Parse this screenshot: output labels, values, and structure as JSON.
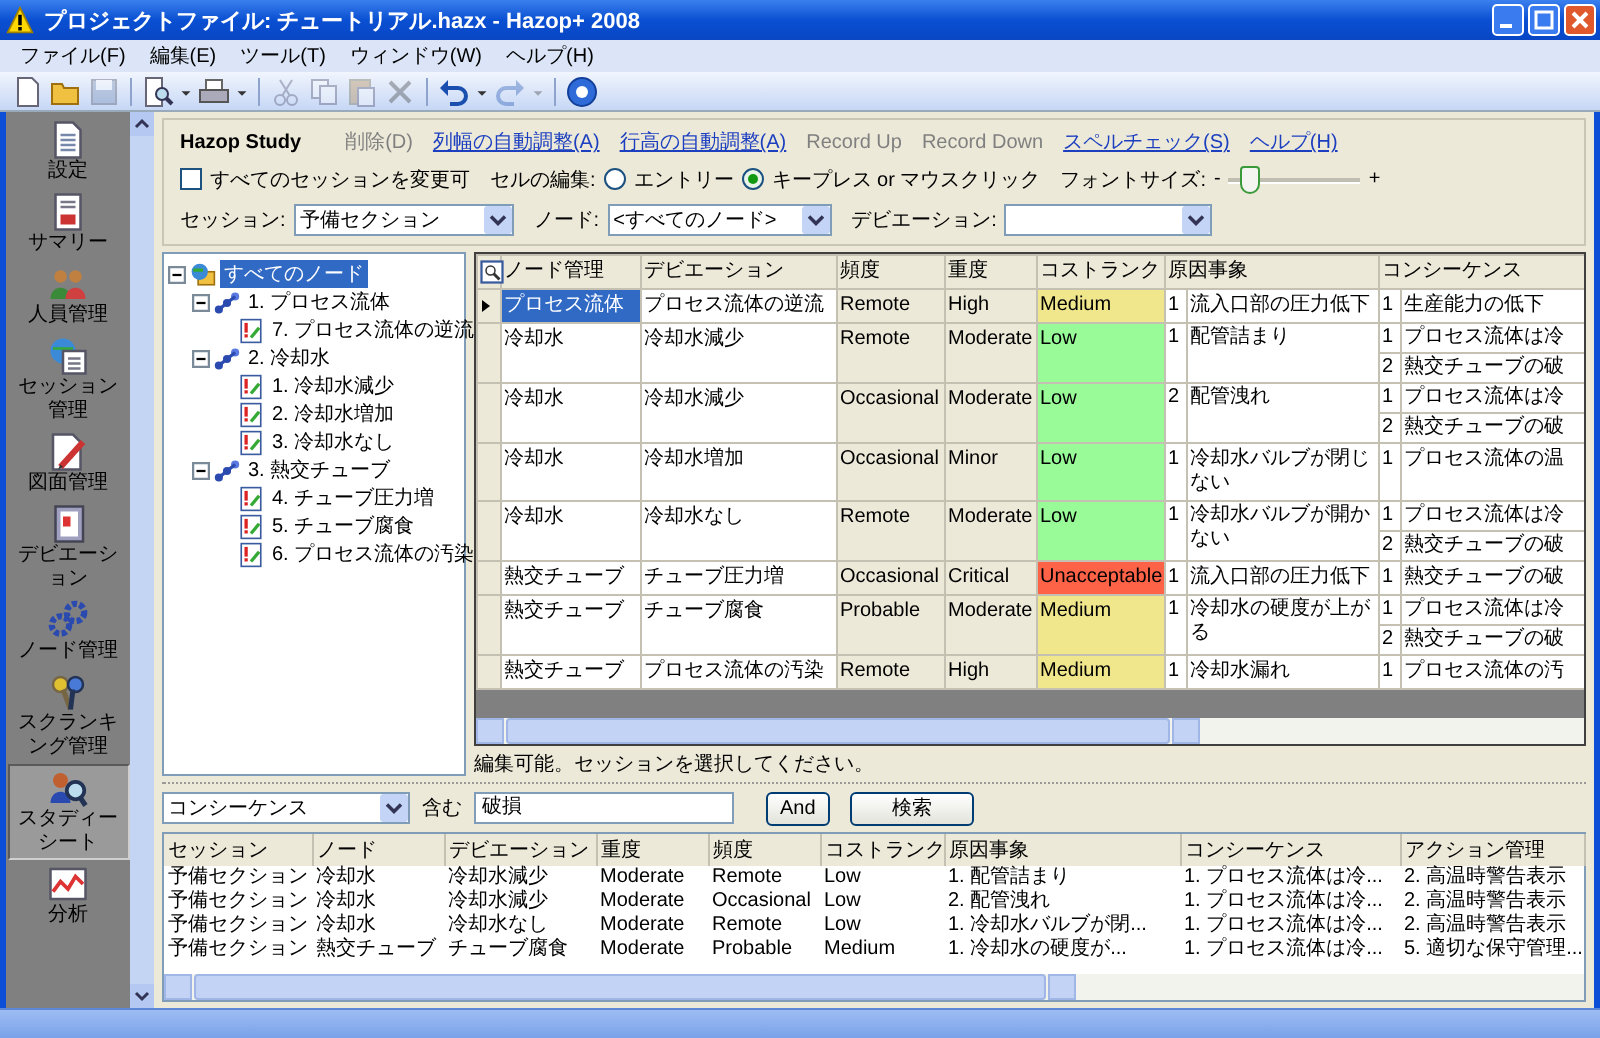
{
  "window": {
    "title": "プロジェクトファイル: チュートリアル.hazx - Hazop+ 2008"
  },
  "menu": [
    "ファイル(F)",
    "編集(E)",
    "ツール(T)",
    "ウィンドウ(W)",
    "ヘルプ(H)"
  ],
  "toolbar": [
    {
      "disabled": false,
      "dropdown": false
    },
    {
      "disabled": false,
      "dropdown": false
    },
    {
      "disabled": true,
      "dropdown": false
    },
    {
      "disabled": false,
      "dropdown": true
    },
    {
      "disabled": false,
      "dropdown": true
    },
    {
      "disabled": true,
      "dropdown": false
    },
    {
      "disabled": true,
      "dropdown": false
    },
    {
      "disabled": true,
      "dropdown": false
    },
    {
      "disabled": true,
      "dropdown": false
    },
    {
      "disabled": false,
      "dropdown": true
    },
    {
      "disabled": true,
      "dropdown": true
    },
    {
      "disabled": false,
      "dropdown": false
    }
  ],
  "sidebar": {
    "items": [
      {
        "label": "設定",
        "selected": false
      },
      {
        "label": "サマリー",
        "selected": false
      },
      {
        "label": "人員管理",
        "selected": false
      },
      {
        "label": "セッション管理",
        "selected": false
      },
      {
        "label": "図面管理",
        "selected": false
      },
      {
        "label": "デビエーション",
        "selected": false
      },
      {
        "label": "ノード管理",
        "selected": false
      },
      {
        "label": "スクランキング管理",
        "selected": false
      },
      {
        "label": "スタディーシート",
        "selected": true
      },
      {
        "label": "分析",
        "selected": false
      }
    ]
  },
  "study": {
    "title": "Hazop Study",
    "links": [
      {
        "label": "削除(D)",
        "disabled": true
      },
      {
        "label": "列幅の自動調整(A)",
        "disabled": false
      },
      {
        "label": "行高の自動調整(A)",
        "disabled": false
      },
      {
        "label": "Record Up",
        "disabled": true
      },
      {
        "label": "Record Down",
        "disabled": true
      },
      {
        "label": "スペルチェック(S)",
        "disabled": false
      },
      {
        "label": "ヘルプ(H)",
        "disabled": false
      }
    ],
    "all_sessions": {
      "label": "すべてのセッションを変更可",
      "checked": false
    },
    "cell_edit": {
      "label": "セルの編集:",
      "options": [
        {
          "label": "エントリー",
          "selected": false
        },
        {
          "label": "キープレス or マウスクリック",
          "selected": true
        }
      ]
    },
    "font_size": {
      "label": "フォントサイズ:",
      "minus": "-",
      "plus": "+",
      "level": 0.1
    },
    "filters": [
      {
        "label": "セッション:",
        "value": "予備セクション"
      },
      {
        "label": "ノード:",
        "value": "<すべてのノード>"
      },
      {
        "label": "デビエーション:"
      }
    ]
  },
  "tree": {
    "label": "すべてのノード",
    "selected": true,
    "expanded": true,
    "children": [
      {
        "label": "1. プロセス流体",
        "selected": false,
        "expanded": true,
        "children": [
          {
            "label": "7. プロセス流体の逆流",
            "selected": false
          }
        ]
      },
      {
        "label": "2. 冷却水",
        "selected": false,
        "expanded": true,
        "children": [
          {
            "label": "1. 冷却水減少",
            "selected": false
          },
          {
            "label": "2. 冷却水増加",
            "selected": false
          },
          {
            "label": "3. 冷却水なし",
            "selected": false
          }
        ]
      },
      {
        "label": "3. 熱交チューブ",
        "selected": false,
        "expanded": true,
        "children": [
          {
            "label": "4. チューブ圧力増",
            "selected": false
          },
          {
            "label": "5. チューブ腐食",
            "selected": false
          },
          {
            "label": "6. プロセス流体の汚染",
            "selected": false
          }
        ]
      }
    ]
  },
  "grid": {
    "columns": [
      "ノード管理",
      "デビエーション",
      "頻度",
      "重度",
      "コストランク",
      "原因事象",
      "コンシーケンス"
    ],
    "rows": [
      {
        "selected": true,
        "node": "プロセス流体",
        "deviation": "プロセス流体の逆流",
        "frequency": "Remote",
        "severity": "High",
        "cost_rank": "Medium",
        "color": "#f0e68c",
        "causes": [
          {
            "no": "1",
            "text": "流入口部の圧力低下"
          }
        ],
        "consequences": [
          {
            "no": "1",
            "text": "生産能力の低下"
          }
        ]
      },
      {
        "selected": false,
        "node": "冷却水",
        "deviation": "冷却水減少",
        "frequency": "Remote",
        "severity": "Moderate",
        "cost_rank": "Low",
        "color": "#98fb98",
        "causes": [
          {
            "no": "1",
            "text": "配管詰まり"
          }
        ],
        "consequences": [
          {
            "no": "1",
            "text": "プロセス流体は冷"
          },
          {
            "no": "2",
            "text": "熱交チューブの破"
          }
        ]
      },
      {
        "selected": false,
        "node": "冷却水",
        "deviation": "冷却水減少",
        "frequency": "Occasional",
        "severity": "Moderate",
        "cost_rank": "Low",
        "color": "#98fb98",
        "causes": [
          {
            "no": "2",
            "text": "配管洩れ"
          }
        ],
        "consequences": [
          {
            "no": "1",
            "text": "プロセス流体は冷"
          },
          {
            "no": "2",
            "text": "熱交チューブの破"
          }
        ]
      },
      {
        "selected": false,
        "node": "冷却水",
        "deviation": "冷却水増加",
        "frequency": "Occasional",
        "severity": "Minor",
        "cost_rank": "Low",
        "color": "#98fb98",
        "causes": [
          {
            "no": "1",
            "text": "冷却水バルブが閉じない"
          }
        ],
        "consequences": [
          {
            "no": "1",
            "text": "プロセス流体の温"
          }
        ]
      },
      {
        "selected": false,
        "node": "冷却水",
        "deviation": "冷却水なし",
        "frequency": "Remote",
        "severity": "Moderate",
        "cost_rank": "Low",
        "color": "#98fb98",
        "causes": [
          {
            "no": "1",
            "text": "冷却水バルブが開かない"
          }
        ],
        "consequences": [
          {
            "no": "1",
            "text": "プロセス流体は冷"
          },
          {
            "no": "2",
            "text": "熱交チューブの破"
          }
        ]
      },
      {
        "selected": false,
        "node": "熱交チューブ",
        "deviation": "チューブ圧力増",
        "frequency": "Occasional",
        "severity": "Critical",
        "cost_rank": "Unacceptable",
        "color": "#ff6347",
        "causes": [
          {
            "no": "1",
            "text": "流入口部の圧力低下"
          }
        ],
        "consequences": [
          {
            "no": "1",
            "text": "熱交チューブの破"
          }
        ]
      },
      {
        "selected": false,
        "node": "熱交チューブ",
        "deviation": "チューブ腐食",
        "frequency": "Probable",
        "severity": "Moderate",
        "cost_rank": "Medium",
        "color": "#f0e68c",
        "causes": [
          {
            "no": "1",
            "text": "冷却水の硬度が上がる"
          }
        ],
        "consequences": [
          {
            "no": "1",
            "text": "プロセス流体は冷"
          },
          {
            "no": "2",
            "text": "熱交チューブの破"
          }
        ]
      },
      {
        "selected": false,
        "node": "熱交チューブ",
        "deviation": "プロセス流体の汚染",
        "frequency": "Remote",
        "severity": "High",
        "cost_rank": "Medium",
        "color": "#f0e68c",
        "causes": [
          {
            "no": "1",
            "text": "冷却水漏れ"
          }
        ],
        "consequences": [
          {
            "no": "1",
            "text": "プロセス流体の汚"
          }
        ]
      }
    ],
    "status": "編集可能。セッションを選択してください。"
  },
  "search": {
    "field": "コンシーケンス",
    "operator": "含む",
    "value": "破損",
    "buttons": [
      "And",
      "検索"
    ]
  },
  "results": {
    "columns": [
      "セッション",
      "ノード",
      "デビエーション",
      "重度",
      "頻度",
      "コストランク",
      "原因事象",
      "コンシーケンス",
      "アクション管理"
    ],
    "rows": [
      [
        "予備セクション",
        "冷却水",
        "冷却水減少",
        "Moderate",
        "Remote",
        "Low",
        "1. 配管詰まり",
        "1. プロセス流体は冷...",
        "2. 高温時警告表示"
      ],
      [
        "予備セクション",
        "冷却水",
        "冷却水減少",
        "Moderate",
        "Occasional",
        "Low",
        "2. 配管洩れ",
        "1. プロセス流体は冷...",
        "2. 高温時警告表示"
      ],
      [
        "予備セクション",
        "冷却水",
        "冷却水なし",
        "Moderate",
        "Remote",
        "Low",
        "1. 冷却水バルブが閉...",
        "1. プロセス流体は冷...",
        "2. 高温時警告表示"
      ],
      [
        "予備セクション",
        "熱交チューブ",
        "チューブ腐食",
        "Moderate",
        "Probable",
        "Medium",
        "1. 冷却水の硬度が...",
        "1. プロセス流体は冷...",
        "5. 適切な保守管理..."
      ]
    ]
  }
}
